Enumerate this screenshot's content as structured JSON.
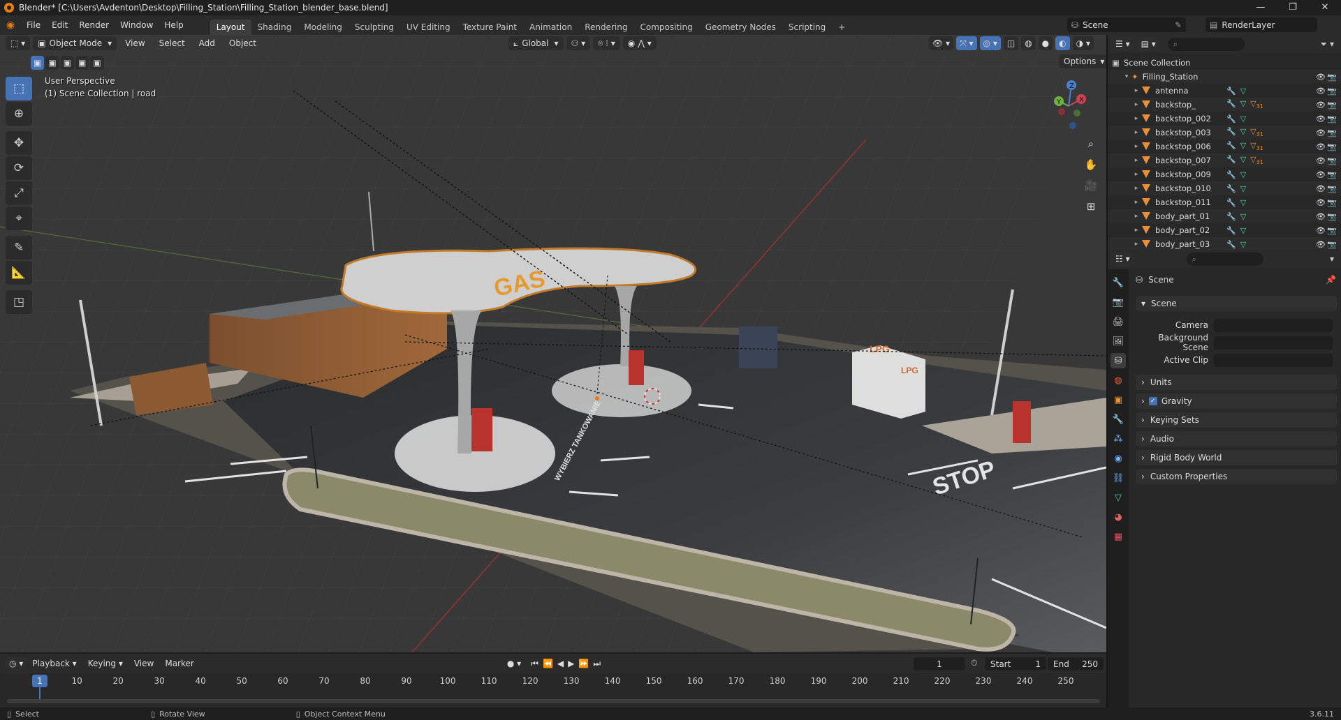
{
  "window": {
    "title": "Blender* [C:\\Users\\Avdenton\\Desktop\\Filling_Station\\Filling_Station_blender_base.blend]",
    "controls": [
      "—",
      "❐",
      "✕"
    ]
  },
  "menubar": {
    "menus": [
      "File",
      "Edit",
      "Render",
      "Window",
      "Help"
    ],
    "workspaces": [
      "Layout",
      "Shading",
      "Modeling",
      "Sculpting",
      "UV Editing",
      "Texture Paint",
      "Animation",
      "Rendering",
      "Compositing",
      "Geometry Nodes",
      "Scripting"
    ],
    "active_workspace": "Layout",
    "add_workspace": "+",
    "scene": "Scene",
    "view_layer": "RenderLayer"
  },
  "viewport_header": {
    "mode": "Object Mode",
    "menus": [
      "View",
      "Select",
      "Add",
      "Object"
    ],
    "transform_orientation": "Global",
    "options": "Options"
  },
  "viewport": {
    "perspective": "User Perspective",
    "collection_info": "(1) Scene Collection | road",
    "gizmo": {
      "x": "X",
      "y": "Y",
      "z": "Z"
    },
    "scene_text": {
      "gas": "GAS",
      "lpg": "LPG",
      "lpg2": "LPG",
      "stop": "STOP",
      "road_text": "WYBIERZ TANKOWANIE"
    }
  },
  "outliner": {
    "root": "Scene Collection",
    "collection": "Filling_Station",
    "items": [
      {
        "name": "antenna",
        "badge": ""
      },
      {
        "name": "backstop_",
        "badge": "31"
      },
      {
        "name": "backstop_002",
        "badge": ""
      },
      {
        "name": "backstop_003",
        "badge": "31"
      },
      {
        "name": "backstop_006",
        "badge": "31"
      },
      {
        "name": "backstop_007",
        "badge": "31"
      },
      {
        "name": "backstop_009",
        "badge": ""
      },
      {
        "name": "backstop_010",
        "badge": ""
      },
      {
        "name": "backstop_011",
        "badge": ""
      },
      {
        "name": "body_part_01",
        "badge": ""
      },
      {
        "name": "body_part_02",
        "badge": ""
      },
      {
        "name": "body_part_03",
        "badge": ""
      }
    ]
  },
  "properties": {
    "context": "Scene",
    "panel_title": "Scene",
    "fields": [
      {
        "label": "Camera"
      },
      {
        "label": "Background Scene"
      },
      {
        "label": "Active Clip"
      }
    ],
    "subpanels": [
      "Units",
      "Gravity",
      "Keying Sets",
      "Audio",
      "Rigid Body World",
      "Custom Properties"
    ]
  },
  "timeline": {
    "menus": [
      "Playback",
      "Keying",
      "View",
      "Marker"
    ],
    "current_frame": "1",
    "start_label": "Start",
    "start": "1",
    "end_label": "End",
    "end": "250",
    "ticks": [
      "1",
      "10",
      "20",
      "30",
      "40",
      "50",
      "60",
      "70",
      "80",
      "90",
      "100",
      "110",
      "120",
      "130",
      "140",
      "150",
      "160",
      "170",
      "180",
      "190",
      "200",
      "210",
      "220",
      "230",
      "240",
      "250"
    ]
  },
  "statusbar": {
    "select": "Select",
    "rotate": "Rotate View",
    "context_menu": "Object Context Menu",
    "version": "3.6.11"
  },
  "colors": {
    "accent": "#4772b3",
    "object_orange": "#e8903a",
    "modifier_blue": "#6cb0ff",
    "mesh_green": "#52d6a8"
  }
}
